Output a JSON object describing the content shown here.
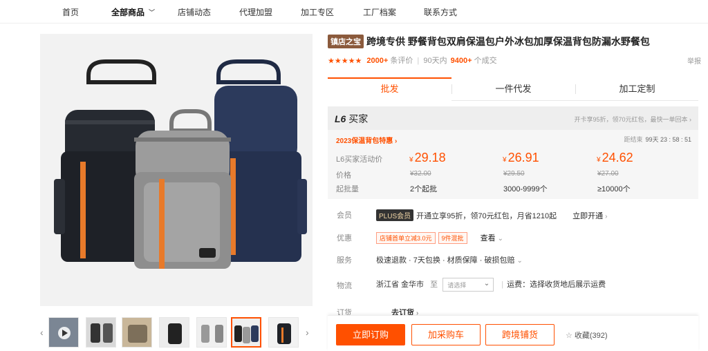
{
  "nav": {
    "items": [
      "首页",
      "全部商品",
      "店铺动态",
      "代理加盟",
      "加工专区",
      "工厂档案",
      "联系方式"
    ]
  },
  "product": {
    "badge": "镇店之宝",
    "title": "跨境专供 野餐背包双肩保温包户外冰包加厚保温背包防漏水野餐包",
    "stars": "★★★★★",
    "review_count": "2000+",
    "review_label": "条评价",
    "sales_period": "90天内",
    "sales_count": "9400+",
    "sales_label": "个成交",
    "report": "举报"
  },
  "tabs": [
    "批发",
    "一件代发",
    "加工定制"
  ],
  "l6": {
    "badge": "L6",
    "title": "买家",
    "note": "开卡享95折，领70元红包，最快一单回本 ›",
    "promo_link": "2023保温背包特惠 ›",
    "timer_label": "距结束",
    "timer": "99天 23 : 58 : 51",
    "rows": {
      "activity_label": "L6买家活动价",
      "price_label": "价格",
      "moq_label": "起批量"
    },
    "tiers": [
      {
        "activity_price": "29.18",
        "price": "¥32.00",
        "qty": "2个起批"
      },
      {
        "activity_price": "26.91",
        "price": "¥29.50",
        "qty": "3000-9999个"
      },
      {
        "activity_price": "24.62",
        "price": "¥27.00",
        "qty": "≥10000个"
      }
    ],
    "currency": "¥"
  },
  "member": {
    "label": "会员",
    "plus": "PLUS会员",
    "desc": "开通立享95折，领70元红包，月省1210起",
    "action": "立即开通"
  },
  "discount": {
    "label": "优惠",
    "coupons": [
      "店铺首单立减3.0元",
      "9件混批"
    ],
    "action": "查看"
  },
  "service": {
    "label": "服务",
    "text": "极速退款 · 7天包换 · 材质保障 · 破损包赔"
  },
  "logistics": {
    "label": "物流",
    "origin": "浙江省 金华市",
    "to": "至",
    "select_placeholder": "请选择",
    "fee": "运费：选择收货地后展示运费"
  },
  "order": {
    "label": "订货",
    "action": "去订货"
  },
  "actions": {
    "buy_now": "立即订购",
    "add_cart": "加采购车",
    "cross_border": "跨境铺货",
    "fav": "收藏(392)"
  },
  "colors": {
    "accent": "#ff5000",
    "treasure_badge": "#8b5a3c"
  }
}
